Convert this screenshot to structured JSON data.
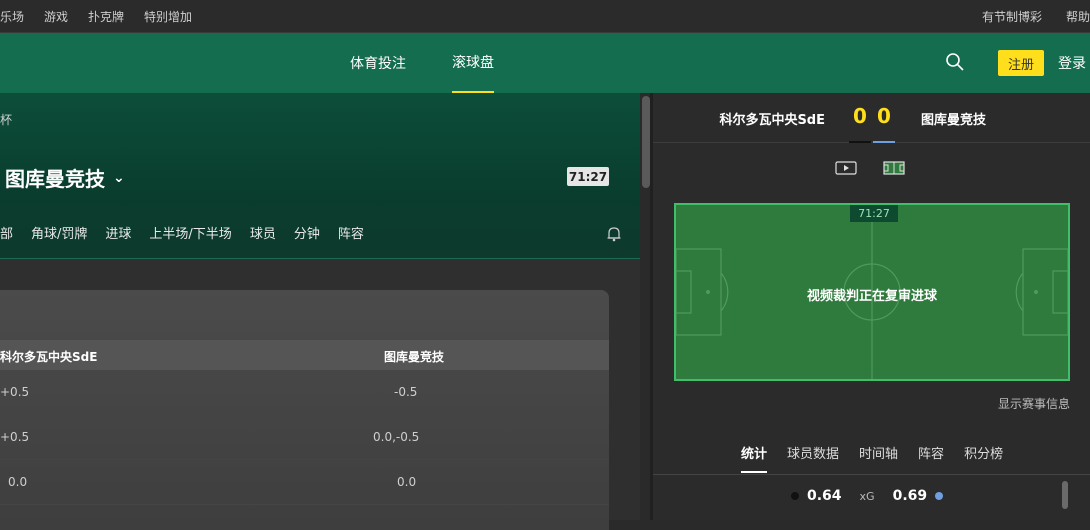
{
  "topbar": {
    "left": [
      "乐场",
      "游戏",
      "扑克牌",
      "特别增加"
    ],
    "right": [
      "有节制博彩",
      "帮助"
    ]
  },
  "nav": {
    "tabs": [
      "体育投注",
      "滚球盘"
    ],
    "register": "注册",
    "login": "登录"
  },
  "match": {
    "league": "杯",
    "team": "图库曼竞技",
    "clock": "71:27",
    "subtabs": [
      "部",
      "角球/罚牌",
      "进球",
      "上半场/下半场",
      "球员",
      "分钟",
      "阵容"
    ]
  },
  "market": {
    "home_header": "科尔多瓦中央SdE",
    "away_header": "图库曼竞技",
    "rows": [
      {
        "home": "+0.5",
        "away": "-0.5"
      },
      {
        "home": "+0.5",
        "away": "0.0,-0.5"
      },
      {
        "home": "0.0",
        "away": "0.0"
      }
    ]
  },
  "scoreboard": {
    "home": "科尔多瓦中央SdE",
    "home_score": "0",
    "away_score": "0",
    "away": "图库曼竞技",
    "pitch_clock": "71:27",
    "pitch_message": "视频裁判正在复审进球",
    "show_info": "显示赛事信息",
    "tabs": [
      "统计",
      "球员数据",
      "时间轴",
      "阵容",
      "积分榜"
    ],
    "xg_label": "xG",
    "xg_home": "0.64",
    "xg_away": "0.69"
  },
  "colors": {
    "accent_yellow": "#ffdf1b",
    "nav_green": "#146d4f",
    "away_blue": "#6f9fe0"
  }
}
